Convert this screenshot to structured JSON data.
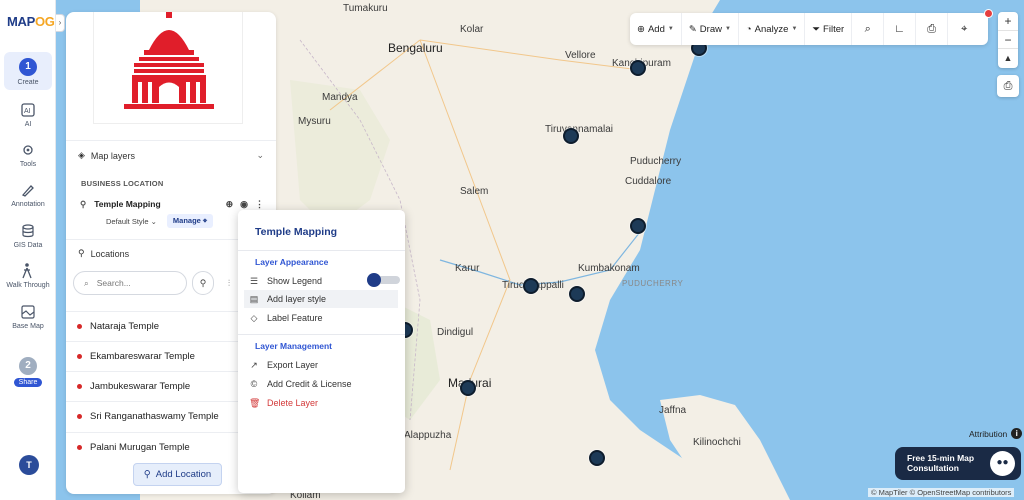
{
  "app": {
    "logo_text": "MAP",
    "logo_accent": "OG"
  },
  "rail": {
    "items": [
      {
        "label": "Create",
        "step": "1",
        "icon": "step-1-icon"
      },
      {
        "label": "AI",
        "icon": "ai-icon"
      },
      {
        "label": "Tools",
        "icon": "tools-icon"
      },
      {
        "label": "Annotation",
        "icon": "annotation-icon"
      },
      {
        "label": "GIS Data",
        "icon": "gis-data-icon"
      },
      {
        "label": "Walk Through",
        "icon": "walk-through-icon"
      },
      {
        "label": "Base Map",
        "icon": "base-map-icon"
      },
      {
        "label": "Share",
        "step": "2",
        "icon": "step-2-icon"
      }
    ],
    "user_initial": "T"
  },
  "panel": {
    "map_layers_label": "Map layers",
    "business_location_label": "BUSINESS LOCATION",
    "layer_name": "Temple Mapping",
    "default_style_label": "Default Style",
    "manage_label": "Manage",
    "locations_label": "Locations",
    "search_placeholder": "Search...",
    "temples": [
      "Nataraja Temple",
      "Ekambareswarar Temple",
      "Jambukeswarar Temple",
      "Sri Ranganathaswamy Temple",
      "Palani Murugan Temple"
    ],
    "add_location_label": "Add Location"
  },
  "context_menu": {
    "title": "Temple Mapping",
    "appearance_label": "Layer Appearance",
    "show_legend": "Show Legend",
    "add_layer_style": "Add layer style",
    "label_feature": "Label Feature",
    "management_label": "Layer Management",
    "export_layer": "Export Layer",
    "add_credit": "Add Credit & License",
    "delete_layer": "Delete Layer",
    "show_legend_on": true
  },
  "toolbar": {
    "add": "Add",
    "draw": "Draw",
    "analyze": "Analyze",
    "filter": "Filter"
  },
  "map": {
    "labels": [
      "Tumakuru",
      "Kolar",
      "Bengaluru",
      "Vellore",
      "Kanchipuram",
      "Mandya",
      "Mysuru",
      "Tiruvannamalai",
      "Puducherry",
      "Salem",
      "Cuddalore",
      "Karur",
      "Kumbakonam",
      "Tiruchirappalli",
      "PUDUCHERRY",
      "Dindigul",
      "Madurai",
      "Jaffna",
      "Kilinochchi",
      "Alappuzha",
      "Kollam"
    ]
  },
  "attribution_label": "Attribution",
  "consultation_label_1": "Free 15-min Map",
  "consultation_label_2": "Consultation",
  "copyright": "© MapTiler © OpenStreetMap contributors",
  "colors": {
    "brand": "#1f3c88",
    "accent": "#3056d3",
    "pin": "#1d3a57",
    "danger": "#d33a3a",
    "land": "#f3efe6",
    "water": "#8cc4ec"
  }
}
